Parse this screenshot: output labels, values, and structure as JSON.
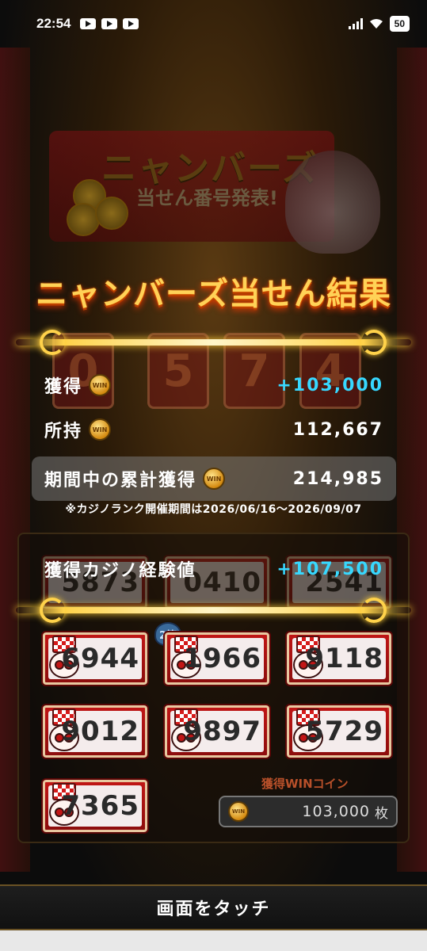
{
  "status_bar": {
    "time": "22:54",
    "battery": "50"
  },
  "banner": {
    "title": "ニャンバーズ",
    "subtitle": "当せん番号発表!"
  },
  "result_title": "ニャンバーズ当せん結果",
  "stats": [
    {
      "label": "獲得",
      "value": "+103,000",
      "highlight": false,
      "cyan": true
    },
    {
      "label": "所持",
      "value": "112,667",
      "highlight": false,
      "cyan": false
    },
    {
      "label": "期間中の累計獲得",
      "value": "214,985",
      "highlight": true,
      "cyan": false
    }
  ],
  "coin_icon_label": "WIN",
  "notice": "※カジノランク開催期間は2026/06/16〜2026/09/07",
  "casino_exp": {
    "label": "獲得カジノ経験値",
    "value": "+107,500"
  },
  "background_digits": [
    "0",
    "5",
    "7",
    "4"
  ],
  "tickets_row_dim": [
    "5873",
    "0410",
    "2541"
  ],
  "tickets": [
    "6944",
    "1966",
    "9118",
    "9012",
    "9897",
    "5729",
    "7365"
  ],
  "badge_2nd": "2等",
  "win_coin": {
    "label": "獲得WINコイン",
    "value": "103,000",
    "unit": "枚"
  },
  "touch_button": "画面をタッチ",
  "colors": {
    "accent_cyan": "#37d8ff",
    "title_gold": "#ffd257",
    "ticket_red": "#c21616"
  }
}
